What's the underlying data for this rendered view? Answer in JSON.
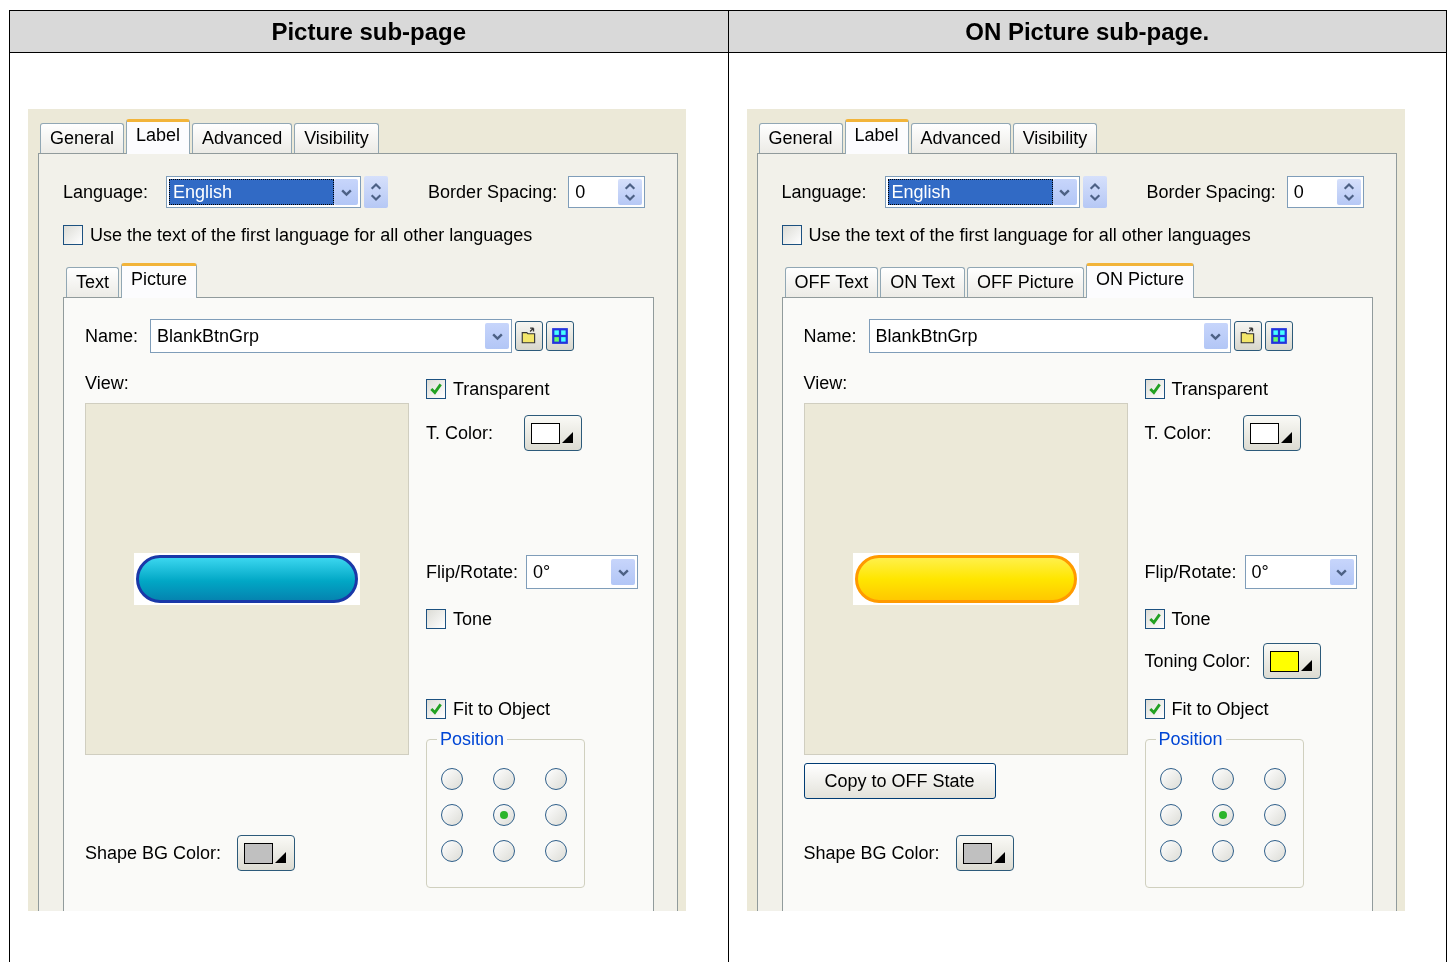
{
  "columns": [
    {
      "heading": "Picture sub-page",
      "panel": {
        "tabs": [
          {
            "label": "General",
            "selected": false
          },
          {
            "label": "Label",
            "selected": true
          },
          {
            "label": "Advanced",
            "selected": false
          },
          {
            "label": "Visibility",
            "selected": false
          }
        ],
        "language": {
          "label": "Language:",
          "value": "English"
        },
        "border_spacing": {
          "label": "Border Spacing:",
          "value": "0"
        },
        "use_first_language": {
          "label": "Use the text of the first language for all other languages",
          "checked": false
        },
        "sub_tabs": [
          {
            "label": "Text",
            "selected": false
          },
          {
            "label": "Picture",
            "selected": true
          }
        ],
        "name": {
          "label": "Name:",
          "value": "BlankBtnGrp"
        },
        "view_label": "View:",
        "preview": {
          "kind": "blue"
        },
        "transparent": {
          "label": "Transparent",
          "checked": true
        },
        "t_color": {
          "label": "T. Color:",
          "color": "#ffffff"
        },
        "flip_rotate": {
          "label": "Flip/Rotate:",
          "value": "0°"
        },
        "tone": {
          "label": "Tone",
          "checked": false
        },
        "fit_to_object": {
          "label": "Fit to Object",
          "checked": true
        },
        "position": {
          "label": "Position",
          "options": [
            {
              "selected": false
            },
            {
              "selected": false
            },
            {
              "selected": false
            },
            {
              "selected": false
            },
            {
              "selected": true
            },
            {
              "selected": false
            },
            {
              "selected": false
            },
            {
              "selected": false
            },
            {
              "selected": false
            }
          ]
        },
        "shape_bg_color": {
          "label": "Shape BG Color:",
          "color": "#c0c0c0"
        }
      }
    },
    {
      "heading": "ON Picture sub-page.",
      "panel": {
        "tabs": [
          {
            "label": "General",
            "selected": false
          },
          {
            "label": "Label",
            "selected": true
          },
          {
            "label": "Advanced",
            "selected": false
          },
          {
            "label": "Visibility",
            "selected": false
          }
        ],
        "language": {
          "label": "Language:",
          "value": "English"
        },
        "border_spacing": {
          "label": "Border Spacing:",
          "value": "0"
        },
        "use_first_language": {
          "label": "Use the text of the first language for all other languages",
          "checked": false
        },
        "sub_tabs": [
          {
            "label": "OFF Text",
            "selected": false
          },
          {
            "label": "ON Text",
            "selected": false
          },
          {
            "label": "OFF Picture",
            "selected": false
          },
          {
            "label": "ON Picture",
            "selected": true
          }
        ],
        "name": {
          "label": "Name:",
          "value": "BlankBtnGrp"
        },
        "view_label": "View:",
        "preview": {
          "kind": "yellow"
        },
        "copy_button": "Copy to OFF State",
        "transparent": {
          "label": "Transparent",
          "checked": true
        },
        "t_color": {
          "label": "T. Color:",
          "color": "#ffffff"
        },
        "flip_rotate": {
          "label": "Flip/Rotate:",
          "value": "0°"
        },
        "tone": {
          "label": "Tone",
          "checked": true
        },
        "toning_color": {
          "label": "Toning Color:",
          "color": "#ffff00"
        },
        "fit_to_object": {
          "label": "Fit to Object",
          "checked": true
        },
        "position": {
          "label": "Position",
          "options": [
            {
              "selected": false
            },
            {
              "selected": false
            },
            {
              "selected": false
            },
            {
              "selected": false
            },
            {
              "selected": true
            },
            {
              "selected": false
            },
            {
              "selected": false
            },
            {
              "selected": false
            },
            {
              "selected": false
            }
          ]
        },
        "shape_bg_color": {
          "label": "Shape BG Color:",
          "color": "#c0c0c0"
        }
      }
    }
  ]
}
